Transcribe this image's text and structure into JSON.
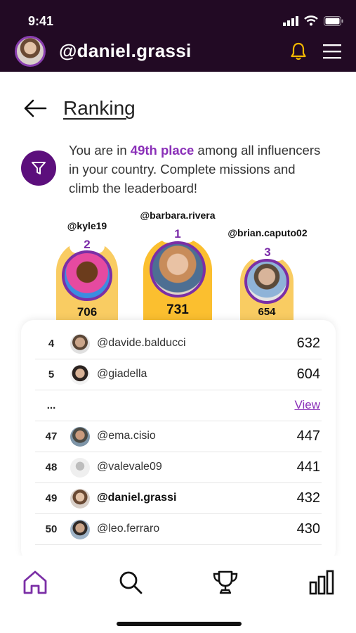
{
  "status_bar": {
    "time": "9:41"
  },
  "header": {
    "username": "@daniel.grassi"
  },
  "page": {
    "title": "Ranking"
  },
  "info": {
    "prefix": "You are in ",
    "highlight": "49th place",
    "suffix": " among all influencers in your country. Complete missions and climb the leaderboard!"
  },
  "podium": [
    {
      "rank": "2",
      "username": "@kyle19",
      "score": "706"
    },
    {
      "rank": "1",
      "username": "@barbara.rivera",
      "score": "731"
    },
    {
      "rank": "3",
      "username": "@brian.caputo02",
      "score": "654"
    }
  ],
  "leaderboard": [
    {
      "rank": "4",
      "username": "@davide.balducci",
      "score": "632"
    },
    {
      "rank": "5",
      "username": "@giadella",
      "score": "604"
    },
    {
      "rank": "...",
      "username": "",
      "score": "",
      "link": "View"
    },
    {
      "rank": "47",
      "username": "@ema.cisio",
      "score": "447"
    },
    {
      "rank": "48",
      "username": "@valevale09",
      "score": "441"
    },
    {
      "rank": "49",
      "username": "@daniel.grassi",
      "score": "432",
      "current_user": true
    },
    {
      "rank": "50",
      "username": "@leo.ferraro",
      "score": "430"
    }
  ],
  "nav": [
    "home-icon",
    "search-icon",
    "trophy-icon",
    "bar-chart-icon"
  ],
  "colors": {
    "header_bg": "#220a24",
    "accent": "#8a2fb8",
    "podium_gold": "#fbbf2f",
    "bell": "#f5b800"
  }
}
